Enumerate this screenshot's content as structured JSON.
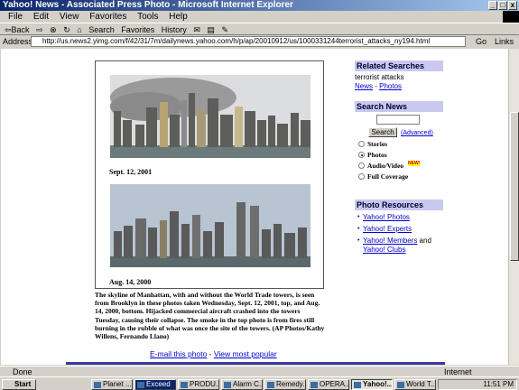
{
  "window": {
    "title": "Yahoo! News - Associated Press Photo - Microsoft Internet Explorer",
    "minimize": "_",
    "maximize": "□",
    "close": "x"
  },
  "menu": [
    "File",
    "Edit",
    "View",
    "Favorites",
    "Tools",
    "Help"
  ],
  "toolbar": {
    "back": "⇦Back",
    "forward": "⇨",
    "stop": "⊗",
    "refresh": "↻",
    "home": "⌂",
    "search": "Search",
    "favorites": "Favorites",
    "history": "History",
    "mail": "✉",
    "print": "▤",
    "edit": "✎"
  },
  "address": {
    "label": "Address",
    "url": "http://us.news2.yimg.com/f/42/31/7m/dailynews.yahoo.com/h/p/ap/20010912/us/1000331244terrorist_attacks_ny194.html",
    "go": "Go",
    "links": "Links"
  },
  "photo": {
    "caption1": "Sept. 12, 2001",
    "caption2": "Aug. 14, 2000",
    "description": "The skyline of Manhattan, with and without the World Trade towers, is seen from Brooklyn in these photos taken Wednesday, Sept. 12, 2001, top, and Aug. 14, 2000, bottom. Hijacked commercial aircraft crashed into the towers Tuesday, causing their collapse. The smoke in the top photo is from fires still burning in the rubble of what was once the site of the towers. (AP Photos/Kathy Willens, Fernando Llano)",
    "email_link": "E-mail this photo",
    "sep": " - ",
    "popular_link": "View most popular"
  },
  "related": {
    "header": "Related Searches",
    "term": "terrorist attacks",
    "news_link": "News",
    "sep": " - ",
    "photos_link": "Photos"
  },
  "search": {
    "header": "Search News",
    "button": "Search",
    "advanced": "(Advanced)",
    "options": [
      "Stories",
      "Photos",
      "Audio/Video",
      "Full Coverage"
    ],
    "new_badge": "NEW!"
  },
  "resources": {
    "header": "Photo Resources",
    "items": [
      "Yahoo! Photos",
      "Yahoo! Experts",
      "Yahoo! Members",
      "Yahoo! Clubs"
    ],
    "and": " and"
  },
  "status": {
    "text": "Done",
    "zone": "Internet"
  },
  "taskbar": {
    "start": "Start",
    "buttons": [
      "Planet ...",
      "Exceed",
      "PRODU...",
      "Alarm C...",
      "Remedy...",
      "OPERA...",
      "Yahoo!...",
      "World T..."
    ],
    "clock": "11:51 PM"
  }
}
